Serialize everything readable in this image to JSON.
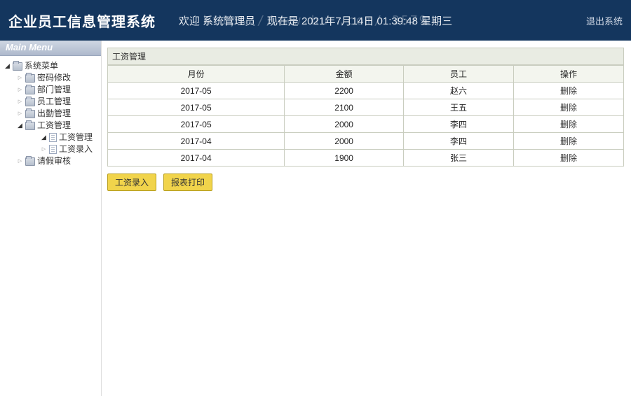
{
  "header": {
    "title": "企业员工信息管理系统",
    "watermark": "https://www.hu         .com/          3579",
    "welcome_prefix": "欢迎",
    "role": "系统管理员",
    "now_prefix": "现在是",
    "datetime": "2021年7月14日 01:39:48 星期三",
    "logout": "退出系统"
  },
  "sidebar": {
    "title": "Main Menu",
    "root": {
      "label": "系统菜单"
    },
    "items": [
      {
        "label": "密码修改"
      },
      {
        "label": "部门管理"
      },
      {
        "label": "员工管理"
      },
      {
        "label": "出勤管理"
      },
      {
        "label": "工资管理"
      },
      {
        "label": "请假审核"
      }
    ],
    "salary_children": [
      {
        "label": "工资管理"
      },
      {
        "label": "工资录入"
      }
    ]
  },
  "main": {
    "panel_title": "工资管理",
    "columns": [
      "月份",
      "金额",
      "员工",
      "操作"
    ],
    "rows": [
      {
        "month": "2017-05",
        "amount": "2200",
        "emp": "赵六",
        "action": "删除"
      },
      {
        "month": "2017-05",
        "amount": "2100",
        "emp": "王五",
        "action": "删除"
      },
      {
        "month": "2017-05",
        "amount": "2000",
        "emp": "李四",
        "action": "删除"
      },
      {
        "month": "2017-04",
        "amount": "2000",
        "emp": "李四",
        "action": "删除"
      },
      {
        "month": "2017-04",
        "amount": "1900",
        "emp": "张三",
        "action": "删除"
      }
    ],
    "buttons": {
      "entry": "工资录入",
      "report": "报表打印"
    }
  }
}
